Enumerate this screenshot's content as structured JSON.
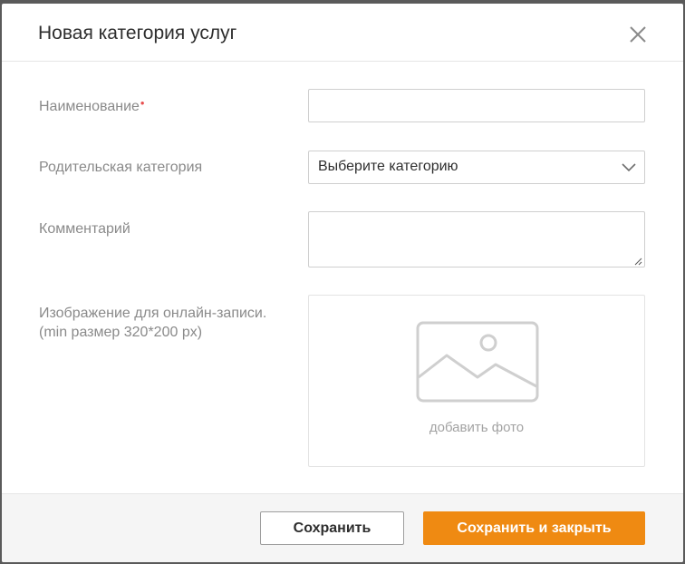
{
  "dialog": {
    "title": "Новая категория услуг"
  },
  "form": {
    "name": {
      "label": "Наименование",
      "required_mark": "•",
      "value": ""
    },
    "parent_category": {
      "label": "Родительская категория",
      "selected": "Выберите категорию"
    },
    "comment": {
      "label": "Комментарий",
      "value": ""
    },
    "image": {
      "label_line1": "Изображение для онлайн-записи.",
      "label_line2": "(min размер 320*200 px)",
      "caption": "добавить фото"
    }
  },
  "footer": {
    "save_label": "Сохранить",
    "save_close_label": "Сохранить и закрыть"
  },
  "colors": {
    "accent": "#ef8a12",
    "required": "#e84e4e",
    "label": "#8a8a8a"
  },
  "icons": {
    "close": "close-icon",
    "chevron": "chevron-down-icon",
    "image_placeholder": "image-placeholder-icon",
    "resize": "resize-handle-icon"
  }
}
